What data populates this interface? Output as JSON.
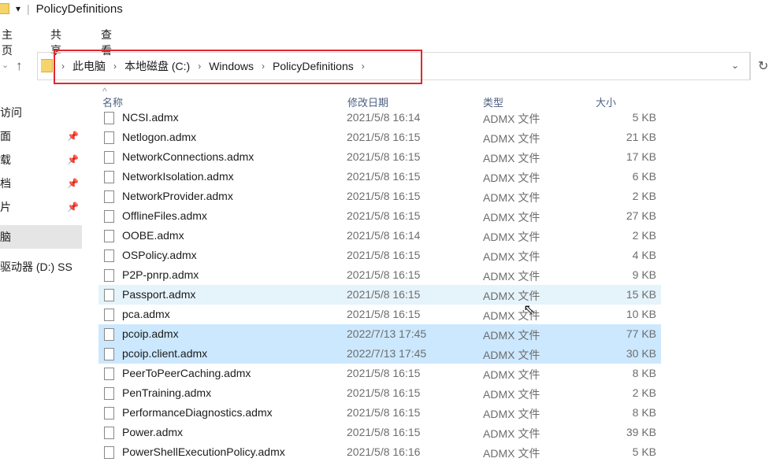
{
  "window": {
    "title": "PolicyDefinitions"
  },
  "ribbon": {
    "tabs": [
      "主页",
      "共享",
      "查看"
    ]
  },
  "address": {
    "crumbs": [
      "此电脑",
      "本地磁盘 (C:)",
      "Windows",
      "PolicyDefinitions"
    ]
  },
  "sidebar": {
    "items": [
      "访问",
      "面",
      "载",
      "档",
      "片",
      "脑",
      "驱动器 (D:) SS"
    ]
  },
  "columns": {
    "name": "名称",
    "date": "修改日期",
    "type": "类型",
    "size": "大小"
  },
  "files": [
    {
      "name": "NCSI.admx",
      "date": "2021/5/8 16:14",
      "type": "ADMX 文件",
      "size": "5 KB"
    },
    {
      "name": "Netlogon.admx",
      "date": "2021/5/8 16:15",
      "type": "ADMX 文件",
      "size": "21 KB"
    },
    {
      "name": "NetworkConnections.admx",
      "date": "2021/5/8 16:15",
      "type": "ADMX 文件",
      "size": "17 KB"
    },
    {
      "name": "NetworkIsolation.admx",
      "date": "2021/5/8 16:15",
      "type": "ADMX 文件",
      "size": "6 KB"
    },
    {
      "name": "NetworkProvider.admx",
      "date": "2021/5/8 16:15",
      "type": "ADMX 文件",
      "size": "2 KB"
    },
    {
      "name": "OfflineFiles.admx",
      "date": "2021/5/8 16:15",
      "type": "ADMX 文件",
      "size": "27 KB"
    },
    {
      "name": "OOBE.admx",
      "date": "2021/5/8 16:14",
      "type": "ADMX 文件",
      "size": "2 KB"
    },
    {
      "name": "OSPolicy.admx",
      "date": "2021/5/8 16:15",
      "type": "ADMX 文件",
      "size": "4 KB"
    },
    {
      "name": "P2P-pnrp.admx",
      "date": "2021/5/8 16:15",
      "type": "ADMX 文件",
      "size": "9 KB"
    },
    {
      "name": "Passport.admx",
      "date": "2021/5/8 16:15",
      "type": "ADMX 文件",
      "size": "15 KB"
    },
    {
      "name": "pca.admx",
      "date": "2021/5/8 16:15",
      "type": "ADMX 文件",
      "size": "10 KB"
    },
    {
      "name": "pcoip.admx",
      "date": "2022/7/13 17:45",
      "type": "ADMX 文件",
      "size": "77 KB"
    },
    {
      "name": "pcoip.client.admx",
      "date": "2022/7/13 17:45",
      "type": "ADMX 文件",
      "size": "30 KB"
    },
    {
      "name": "PeerToPeerCaching.admx",
      "date": "2021/5/8 16:15",
      "type": "ADMX 文件",
      "size": "8 KB"
    },
    {
      "name": "PenTraining.admx",
      "date": "2021/5/8 16:15",
      "type": "ADMX 文件",
      "size": "2 KB"
    },
    {
      "name": "PerformanceDiagnostics.admx",
      "date": "2021/5/8 16:15",
      "type": "ADMX 文件",
      "size": "8 KB"
    },
    {
      "name": "Power.admx",
      "date": "2021/5/8 16:15",
      "type": "ADMX 文件",
      "size": "39 KB"
    },
    {
      "name": "PowerShellExecutionPolicy.admx",
      "date": "2021/5/8 16:16",
      "type": "ADMX 文件",
      "size": "5 KB"
    }
  ]
}
